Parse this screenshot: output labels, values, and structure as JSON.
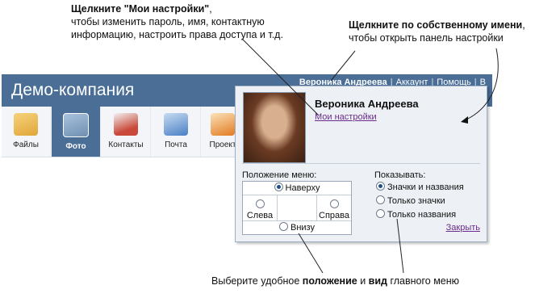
{
  "annotations": {
    "top_left_bold": "Щелкните \"Мои настройки\"",
    "top_left_rest": ",\nчтобы изменить пароль, имя, контактную\nинформацию, настроить права доступа и т.д.",
    "top_right_bold": "Щелкните по собственному имени",
    "top_right_rest": ",\nчтобы открыть панель настройки",
    "bottom_pre": "Выберите удобное ",
    "bottom_bold1": "положение",
    "bottom_mid": " и ",
    "bottom_bold2": "вид",
    "bottom_post": " главного меню"
  },
  "header": {
    "company": "Демо-компания",
    "user": "Вероника Андреева",
    "links": [
      "Аккаунт",
      "Помощь",
      "В"
    ]
  },
  "toolbar": {
    "items": [
      {
        "label": "Файлы",
        "active": false,
        "color": "#e0a63a"
      },
      {
        "label": "Фото",
        "active": true,
        "color": "#6f8fb3"
      },
      {
        "label": "Контакты",
        "active": false,
        "color": "#c94a3a"
      },
      {
        "label": "Почта",
        "active": false,
        "color": "#4a7fc4"
      },
      {
        "label": "Проект",
        "active": false,
        "color": "#e27b22"
      }
    ]
  },
  "panel": {
    "name": "Вероника Андреева",
    "my_settings": "Мои настройки",
    "menu_position_label": "Положение меню:",
    "positions": {
      "top": "Наверху",
      "left": "Слева",
      "right": "Справа",
      "bottom": "Внизу"
    },
    "selected_position": "top",
    "show_label": "Показывать:",
    "show_options": [
      "Значки и названия",
      "Только значки",
      "Только названия"
    ],
    "selected_show_index": 0,
    "close": "Закрыть"
  },
  "colors": {
    "header_bg": "#4a6e96",
    "panel_bg": "#edf1f5",
    "link": "#6a2b8c"
  }
}
